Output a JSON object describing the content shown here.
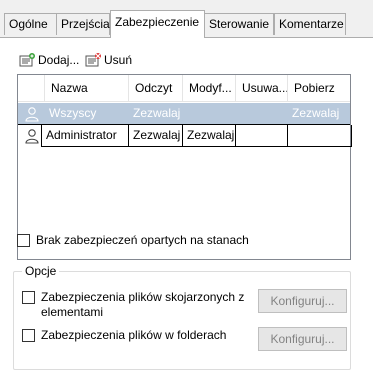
{
  "tabs": [
    {
      "label": "Ogólne"
    },
    {
      "label": "Przejścia"
    },
    {
      "label": "Zabezpieczenie"
    },
    {
      "label": "Sterowanie"
    },
    {
      "label": "Komentarze"
    }
  ],
  "active_tab": "Zabezpieczenie",
  "toolbar": {
    "add_label": "Dodaj...",
    "remove_label": "Usuń"
  },
  "grid": {
    "columns": [
      "Nazwa",
      "Odczyt",
      "Modyf...",
      "Usuwa...",
      "Pobierz"
    ],
    "rows": [
      {
        "name": "Wszyscy",
        "read": "Zezwalaj",
        "modify": "",
        "delete": "",
        "take": "Zezwalaj",
        "selected": true
      },
      {
        "name": "Administrator",
        "read": "Zezwalaj",
        "modify": "Zezwalaj",
        "delete": "",
        "take": "",
        "selected": false
      }
    ]
  },
  "no_state_security": {
    "label": "Brak zabezpieczeń opartych na stanach",
    "checked": false
  },
  "options": {
    "title": "Opcje",
    "linked_files": {
      "label_line1": "Zabezpieczenia plików skojarzonych z",
      "label_line2": "elementami",
      "checked": false,
      "button": "Konfiguruj..."
    },
    "folder_files": {
      "label": "Zabezpieczenia plików w folderach",
      "checked": false,
      "button": "Konfiguruj..."
    }
  },
  "colors": {
    "selection": "#b8c9dc",
    "disabled_text": "#838383"
  }
}
